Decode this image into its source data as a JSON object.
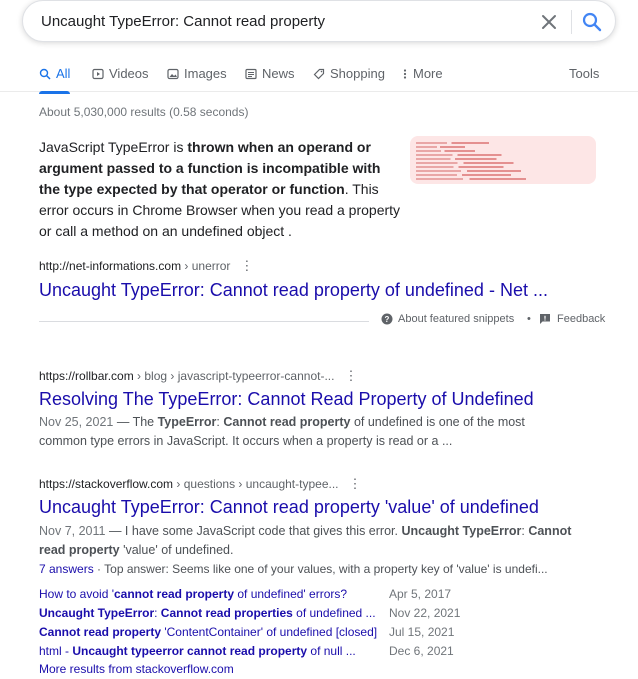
{
  "search": {
    "query": "Uncaught TypeError: Cannot read property"
  },
  "tabs": [
    {
      "label": "All",
      "icon": "search-icon",
      "active": true
    },
    {
      "label": "Videos",
      "icon": "video-icon"
    },
    {
      "label": "Images",
      "icon": "image-icon"
    },
    {
      "label": "News",
      "icon": "news-icon"
    },
    {
      "label": "Shopping",
      "icon": "tag-icon"
    },
    {
      "label": "More",
      "icon": "more-vert-icon"
    }
  ],
  "tools_label": "Tools",
  "stats": "About 5,030,000 results (0.58 seconds)",
  "featured": {
    "text": [
      {
        "t": "JavaScript TypeError is ",
        "b": false
      },
      {
        "t": "thrown when an operand or argument passed to a function is incompatible with the type expected by that operator or function",
        "b": true
      },
      {
        "t": ". This error occurs in Chrome Browser when you read a property or call a method on an undefined object .",
        "b": false
      }
    ],
    "cite": "http://net-informations.com",
    "cite_path": " › unerror",
    "title": "Uncaught TypeError: Cannot read property of undefined - Net ...",
    "about_label": "About featured snippets",
    "bullet": "•",
    "feedback_label": "Feedback"
  },
  "results": [
    {
      "cite": "https://rollbar.com",
      "cite_path": " › blog › javascript-typeerror-cannot-...",
      "title": "Resolving The TypeError: Cannot Read Property of Undefined",
      "date": "Nov 25, 2021",
      "desc": [
        {
          "t": " — The ",
          "b": false
        },
        {
          "t": "TypeError",
          "b": true
        },
        {
          "t": ": ",
          "b": false
        },
        {
          "t": "Cannot read property",
          "b": true
        },
        {
          "t": " of undefined is one of the most common type errors in JavaScript. It occurs when a property is read or a ...",
          "b": false
        }
      ]
    },
    {
      "cite": "https://stackoverflow.com",
      "cite_path": " › questions › uncaught-typee...",
      "title": "Uncaught TypeError: Cannot read property 'value' of undefined",
      "date": "Nov 7, 2011",
      "desc": [
        {
          "t": " — I have some JavaScript code that gives this error. ",
          "b": false
        },
        {
          "t": "Uncaught TypeError",
          "b": true
        },
        {
          "t": ": ",
          "b": false
        },
        {
          "t": "Cannot read property",
          "b": true
        },
        {
          "t": " 'value' of undefined.",
          "b": false
        }
      ],
      "answers_count": "7 answers",
      "answers_text": " · Top answer: Seems like one of your values, with a property key of 'value' is undefi...",
      "sublinks": [
        {
          "parts": [
            {
              "t": "How to avoid '",
              "b": false
            },
            {
              "t": "cannot read property",
              "b": true
            },
            {
              "t": " of undefined' errors?",
              "b": false
            }
          ],
          "date": "Apr 5, 2017"
        },
        {
          "parts": [
            {
              "t": "Uncaught TypeError",
              "b": true
            },
            {
              "t": ": ",
              "b": false
            },
            {
              "t": "Cannot read properties",
              "b": true
            },
            {
              "t": " of undefined ...",
              "b": false
            }
          ],
          "date": "Nov 22, 2021"
        },
        {
          "parts": [
            {
              "t": "Cannot read property",
              "b": true
            },
            {
              "t": " 'ContentContainer' of undefined [closed]",
              "b": false
            }
          ],
          "date": "Jul 15, 2021"
        },
        {
          "parts": [
            {
              "t": "html - ",
              "b": false
            },
            {
              "t": "Uncaught typeerror cannot read property",
              "b": true
            },
            {
              "t": " of null ...",
              "b": false
            }
          ],
          "date": "Dec 6, 2021"
        }
      ],
      "more_results": "More results from stackoverflow.com"
    }
  ],
  "colors": {
    "link": "#1a0dab",
    "accent": "#1a73e8",
    "snippet_thumb": "#fde6e6"
  }
}
